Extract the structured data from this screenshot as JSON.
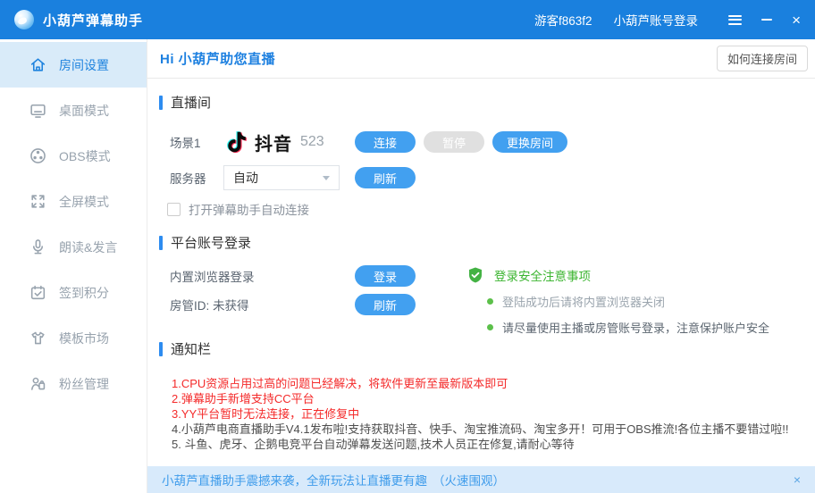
{
  "colors": {
    "titlebar": "#1a80de",
    "accent_button": "#42a0f0",
    "disabled_button": "#e0e0e0",
    "sidebar_active_bg": "#d9ebf9",
    "sidebar_active_text": "#1f83de",
    "section_marker": "#2d8cf0",
    "success_green": "#43b244",
    "alert_red": "#f42a2a",
    "footer_bg": "#d8eafb",
    "footer_text": "#3f9ceb"
  },
  "titlebar": {
    "app_title": "小葫芦弹幕助手",
    "guest_label": "游客f863f2",
    "account_login_label": "小葫芦账号登录",
    "close_icon": "×"
  },
  "sidebar": {
    "items": [
      {
        "label": "房间设置",
        "icon": "home-icon",
        "active": true
      },
      {
        "label": "桌面模式",
        "icon": "desktop-icon",
        "active": false
      },
      {
        "label": "OBS模式",
        "icon": "obs-icon",
        "active": false
      },
      {
        "label": "全屏模式",
        "icon": "fullscreen-icon",
        "active": false
      },
      {
        "label": "朗读&发言",
        "icon": "microphone-icon",
        "active": false
      },
      {
        "label": "签到积分",
        "icon": "calendar-check-icon",
        "active": false
      },
      {
        "label": "模板市场",
        "icon": "tshirt-icon",
        "active": false
      },
      {
        "label": "粉丝管理",
        "icon": "fans-icon",
        "active": false
      }
    ]
  },
  "header": {
    "greeting": "Hi 小葫芦助您直播",
    "help_button": "如何连接房间"
  },
  "live_room": {
    "section_title": "直播间",
    "scene_label": "场景1",
    "platform_name": "抖音",
    "room_id": "523",
    "connect_button": "连接",
    "pause_button": "暂停",
    "change_room_button": "更换房间",
    "server_label": "服务器",
    "server_value": "自动",
    "refresh_button": "刷新",
    "auto_connect_label": "打开弹幕助手自动连接"
  },
  "platform_login": {
    "section_title": "平台账号登录",
    "browser_login_label": "内置浏览器登录",
    "login_button": "登录",
    "room_manager_label": "房管ID: 未获得",
    "refresh_button": "刷新",
    "tips_title": "登录安全注意事项",
    "tips": [
      "登陆成功后请将内置浏览器关闭",
      "请尽量使用主播或房管账号登录，注意保护账户安全"
    ]
  },
  "notices": {
    "section_title": "通知栏",
    "items": [
      {
        "text": "1.CPU资源占用过高的问题已经解决，将软件更新至最新版本即可",
        "highlight": true
      },
      {
        "text": "2.弹幕助手新增支持CC平台",
        "highlight": true
      },
      {
        "text": "3.YY平台暂时无法连接，正在修复中",
        "highlight": true
      },
      {
        "text": "4.小葫芦电商直播助手V4.1发布啦!支持获取抖音、快手、淘宝推流码、淘宝多开！可用于OBS推流!各位主播不要错过啦!!",
        "highlight": false
      },
      {
        "text": "5. 斗鱼、虎牙、企鹅电竞平台自动弹幕发送问题,技术人员正在修复,请耐心等待",
        "highlight": false
      }
    ]
  },
  "footer": {
    "text": "小葫芦直播助手震撼来袭，全新玩法让直播更有趣",
    "link": "（火速围观）",
    "close_icon": "×"
  }
}
